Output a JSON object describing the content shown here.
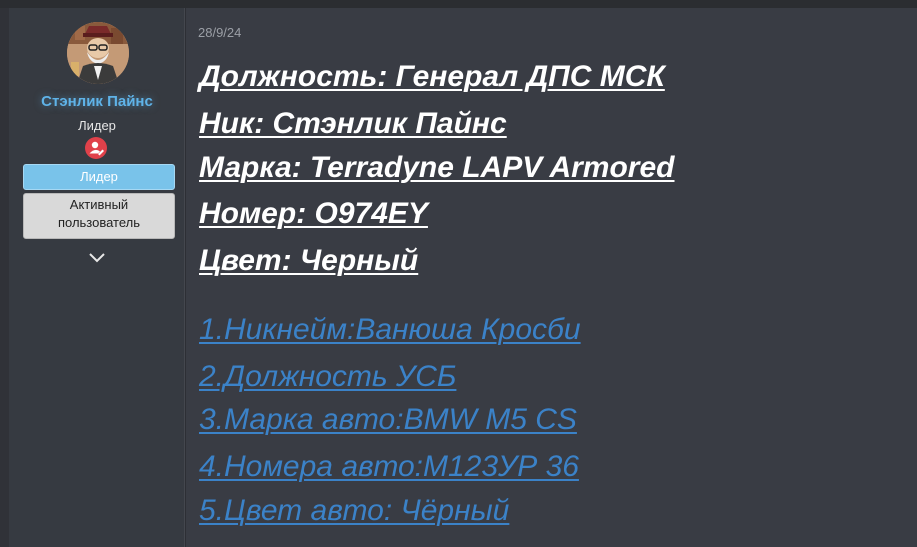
{
  "user": {
    "name": "Стэнлик Пайнс",
    "role": "Лидер",
    "banners": [
      "Лидер",
      "Активный пользователь"
    ],
    "banner_active_line1": "Активный",
    "banner_active_line2": "пользователь",
    "role_icon": "user-edit-icon",
    "expand_icon": "chevron-down-icon"
  },
  "post": {
    "date": "28/9/24",
    "info_lines": [
      "Должность: Генерал ДПС МСК",
      "Ник: Стэнлик Пайнс",
      "Марка: Terradyne LAPV Armored",
      "Номер: O974EY",
      "Цвет: Черный"
    ],
    "link_lines": [
      "1.Никнейм:Ванюша Кросби",
      "2.Должность УСБ",
      "3.Марка авто:BMW M5 CS",
      "4.Номера авто:M123УР 36",
      "5.Цвет авто: Чёрный"
    ]
  },
  "colors": {
    "username": "#5fb3e8",
    "link": "#3b82c8",
    "leader_banner": "#79c3ea",
    "role_icon_bg": "#e0414a"
  }
}
